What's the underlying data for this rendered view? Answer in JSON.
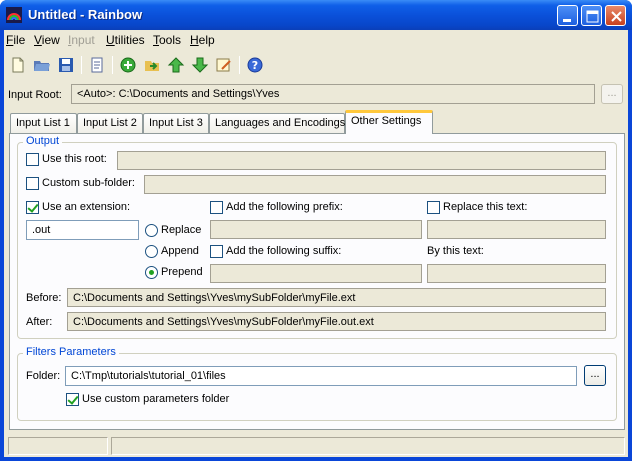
{
  "window": {
    "title": "Untitled - Rainbow"
  },
  "menu": [
    {
      "label": "File",
      "accel": "F",
      "rest": "ile",
      "enabled": true
    },
    {
      "label": "View",
      "accel": "V",
      "rest": "iew",
      "enabled": true
    },
    {
      "label": "Input",
      "accel": "I",
      "rest": "nput",
      "enabled": false
    },
    {
      "label": "Utilities",
      "accel": "U",
      "rest": "tilities",
      "enabled": true
    },
    {
      "label": "Tools",
      "accel": "T",
      "rest": "ools",
      "enabled": true
    },
    {
      "label": "Help",
      "accel": "H",
      "rest": "elp",
      "enabled": true
    }
  ],
  "toolbar": [
    "new-icon",
    "open-icon",
    "save-icon",
    "notes-icon",
    "add-icon",
    "import-icon",
    "move-up-icon",
    "move-down-icon",
    "edit-icon",
    "help-icon"
  ],
  "input_root": {
    "label": "Input Root:",
    "value": "<Auto>:  C:\\Documents and Settings\\Yves",
    "browse": "..."
  },
  "tabs": [
    {
      "label": "Input List 1",
      "active": false
    },
    {
      "label": "Input List 2",
      "active": false
    },
    {
      "label": "Input List 3",
      "active": false
    },
    {
      "label": "Languages and Encodings",
      "active": false
    },
    {
      "label": "Other Settings",
      "active": true
    }
  ],
  "output": {
    "group_title": "Output",
    "use_root": {
      "label": "Use this root:",
      "checked": false,
      "value": ""
    },
    "custom_subfolder": {
      "label": "Custom sub-folder:",
      "checked": false,
      "value": ""
    },
    "use_extension": {
      "label": "Use an extension:",
      "checked": true,
      "value": ".out"
    },
    "add_prefix": {
      "label": "Add the following prefix:",
      "checked": false,
      "value": ""
    },
    "replace_text": {
      "label": "Replace this text:",
      "checked": false,
      "value": ""
    },
    "add_suffix": {
      "label": "Add the following suffix:",
      "checked": false,
      "value": ""
    },
    "by_text": {
      "label": "By this text:",
      "value": ""
    },
    "ext_mode": {
      "options": [
        "Replace",
        "Append",
        "Prepend"
      ],
      "selected": "Prepend"
    },
    "before": {
      "label": "Before:",
      "value": "C:\\Documents and Settings\\Yves\\mySubFolder\\myFile.ext"
    },
    "after": {
      "label": "After:",
      "value": "C:\\Documents and Settings\\Yves\\mySubFolder\\myFile.out.ext"
    }
  },
  "filters": {
    "group_title": "Filters Parameters",
    "folder": {
      "label": "Folder:",
      "value": "C:\\Tmp\\tutorials\\tutorial_01\\files",
      "browse": "..."
    },
    "use_custom": {
      "label": "Use custom parameters folder",
      "checked": true
    }
  },
  "colors": {
    "title_bar": "#0a4fd8",
    "face": "#ece9d8",
    "group_title": "#0046d5",
    "active_tab_accent": "#ffc83c",
    "check_mark": "#21a121"
  }
}
